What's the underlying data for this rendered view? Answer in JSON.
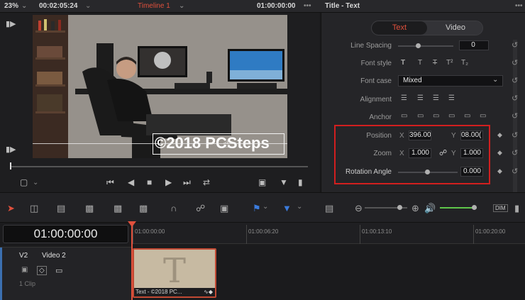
{
  "topbar": {
    "zoom": "23%",
    "timecode": "00:02:05:24",
    "timeline_name": "Timeline 1",
    "record_timecode": "01:00:00:00",
    "more": "•••"
  },
  "viewer": {
    "watermark": "©2018 PCSteps"
  },
  "inspector": {
    "title": "Title - Text",
    "tabs": [
      "Text",
      "Video"
    ],
    "line_spacing": {
      "label": "Line Spacing",
      "value": "0"
    },
    "font_style": {
      "label": "Font style",
      "glyphs": [
        "T",
        "T",
        "T",
        "T²",
        "T₂"
      ]
    },
    "font_case": {
      "label": "Font case",
      "value": "Mixed"
    },
    "alignment": {
      "label": "Alignment"
    },
    "anchor": {
      "label": "Anchor"
    },
    "position": {
      "label": "Position",
      "x_label": "X",
      "x": "396.00",
      "y_label": "Y",
      "y": "08.00("
    },
    "zoom": {
      "label": "Zoom",
      "x_label": "X",
      "x": "1.000",
      "y_label": "Y",
      "y": "1.000"
    },
    "rotation": {
      "label": "Rotation Angle",
      "value": "0.000"
    }
  },
  "toolbar": {
    "dim_label": "DIM"
  },
  "timeline": {
    "timecode": "01:00:00:00",
    "ruler_labels": [
      "01:00:00:00",
      "01:00:06:20",
      "01:00:13:10",
      "01:00:20:00"
    ],
    "track": {
      "id": "V2",
      "name": "Video 2",
      "clips": "1 Clip"
    },
    "clip": {
      "glyph": "T",
      "label": "Text - ©2018 PC..."
    }
  },
  "colors": {
    "accent": "#e0503c",
    "highlight_box": "#d21f1f",
    "audio_meter": "#5fc74a",
    "marker_blue": "#3b7bdc"
  }
}
